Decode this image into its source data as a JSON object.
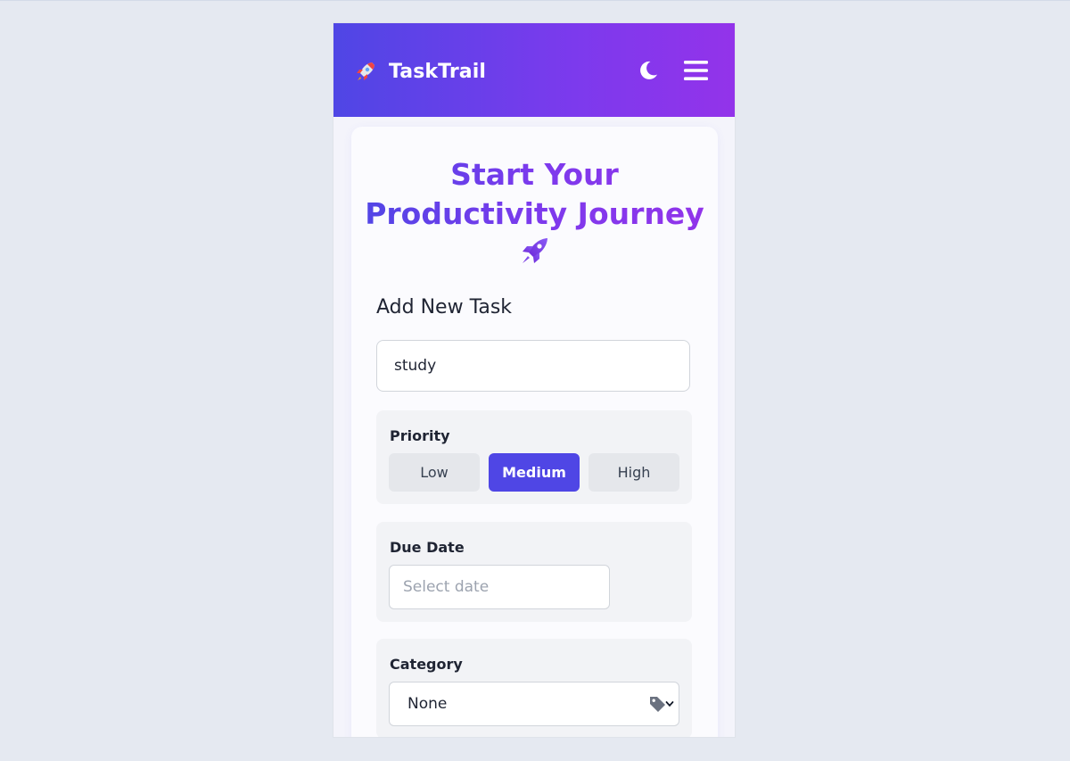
{
  "app": {
    "name": "TaskTrail",
    "brand_icon": "rocket-icon",
    "theme_toggle_icon": "moon-icon",
    "menu_icon": "hamburger-menu-icon"
  },
  "hero": {
    "title_line1": "Start Your",
    "title_line2": "Productivity Journey",
    "icon": "rocket-icon"
  },
  "form": {
    "section_title": "Add New Task",
    "task_input": {
      "value": "study",
      "placeholder": ""
    },
    "priority": {
      "label": "Priority",
      "options": [
        "Low",
        "Medium",
        "High"
      ],
      "selected": "Medium"
    },
    "due_date": {
      "label": "Due Date",
      "placeholder": "Select date"
    },
    "category": {
      "label": "Category",
      "selected": "None",
      "icon": "tag-icon"
    }
  },
  "colors": {
    "accent": "#4f46e5",
    "gradient_start": "#4f46e5",
    "gradient_end": "#9333ea",
    "page_background": "#e5e9f1"
  }
}
